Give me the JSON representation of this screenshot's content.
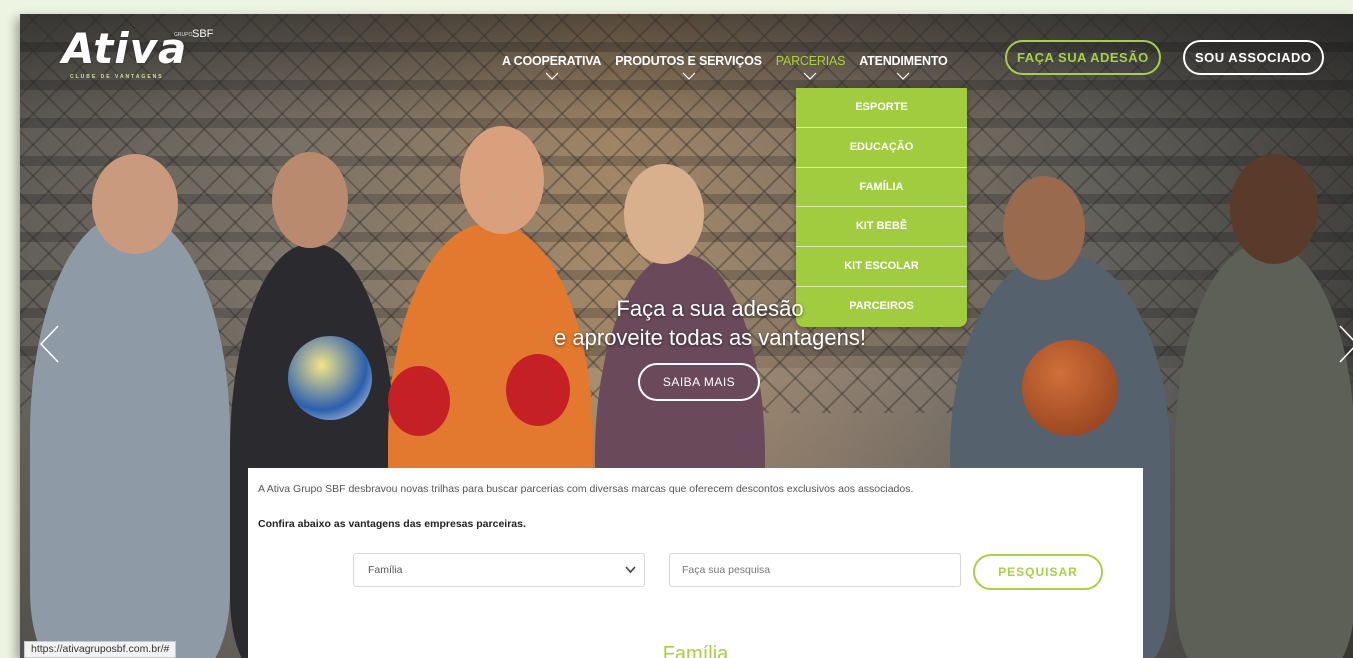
{
  "brand": {
    "name": "Ativa",
    "tagline": "CLUBE DE VANTAGENS",
    "group": "SBF",
    "group_prefix": "GRUPO"
  },
  "nav": {
    "items": [
      {
        "label": "A COOPERATIVA"
      },
      {
        "label": "PRODUTOS E SERVIÇOS"
      },
      {
        "label": "PARCERIAS"
      },
      {
        "label": "ATENDIMENTO"
      }
    ],
    "cta_join": "FAÇA SUA ADESÃO",
    "cta_member": "SOU ASSOCIADO"
  },
  "dropdown": {
    "items": [
      "ESPORTE",
      "EDUCAÇÃO",
      "FAMÍLIA",
      "KIT BEBÊ",
      "KIT ESCOLAR",
      "PARCEIROS"
    ]
  },
  "hero": {
    "line1": "Faça a sua adesão",
    "line2": "e aproveite todas as vantagens!",
    "button": "SAIBA MAIS"
  },
  "panel": {
    "intro": "A Ativa Grupo SBF desbravou novas trilhas para buscar parcerias com diversas marcas que oferecem descontos exclusivos aos associados.",
    "confira": "Confira abaixo as vantagens das empresas parceiras.",
    "category_selected": "Família",
    "search_placeholder": "Faça sua pesquisa",
    "search_button": "PESQUISAR",
    "section_title": "Família"
  },
  "statusbar": {
    "url": "https://ativagruposbf.com.br/#"
  },
  "colors": {
    "accent": "#a8cf45",
    "dropdown": "#a2cc3f"
  }
}
